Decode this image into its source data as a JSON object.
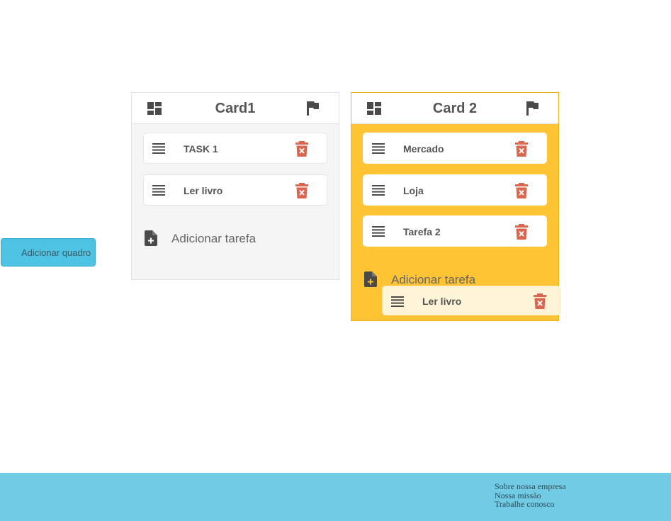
{
  "add_board": {
    "label": "Adicionar quadro"
  },
  "boards": [
    {
      "title": "Card1",
      "tasks": [
        {
          "label": "TASK 1"
        },
        {
          "label": "Ler livro"
        }
      ],
      "add_task_label": "Adicionar tarefa"
    },
    {
      "title": "Card 2",
      "tasks": [
        {
          "label": "Mercado"
        },
        {
          "label": "Loja"
        },
        {
          "label": "Tarefa 2"
        }
      ],
      "add_task_label": "Adicionar tarefa"
    }
  ],
  "dragging_task": {
    "label": "Ler livro"
  },
  "footer": {
    "links": [
      {
        "label": "Sobre nossa empresa"
      },
      {
        "label": "Nossa missão"
      },
      {
        "label": "Trabalhe conosco"
      }
    ]
  },
  "colors": {
    "board_highlight": "#ffc434",
    "board_default": "#f5f5f5",
    "footer": "#72cbe5",
    "add_board_button": "#4fc3e3",
    "trash_icon": "#d9674f",
    "icon_dark": "#4a4a4a"
  },
  "icons": {
    "board_header_left": "dashboard-icon",
    "board_header_right": "flag-icon",
    "task_handle": "drag-handle-icon",
    "task_delete": "trash-icon",
    "add_task": "add-file-icon"
  }
}
